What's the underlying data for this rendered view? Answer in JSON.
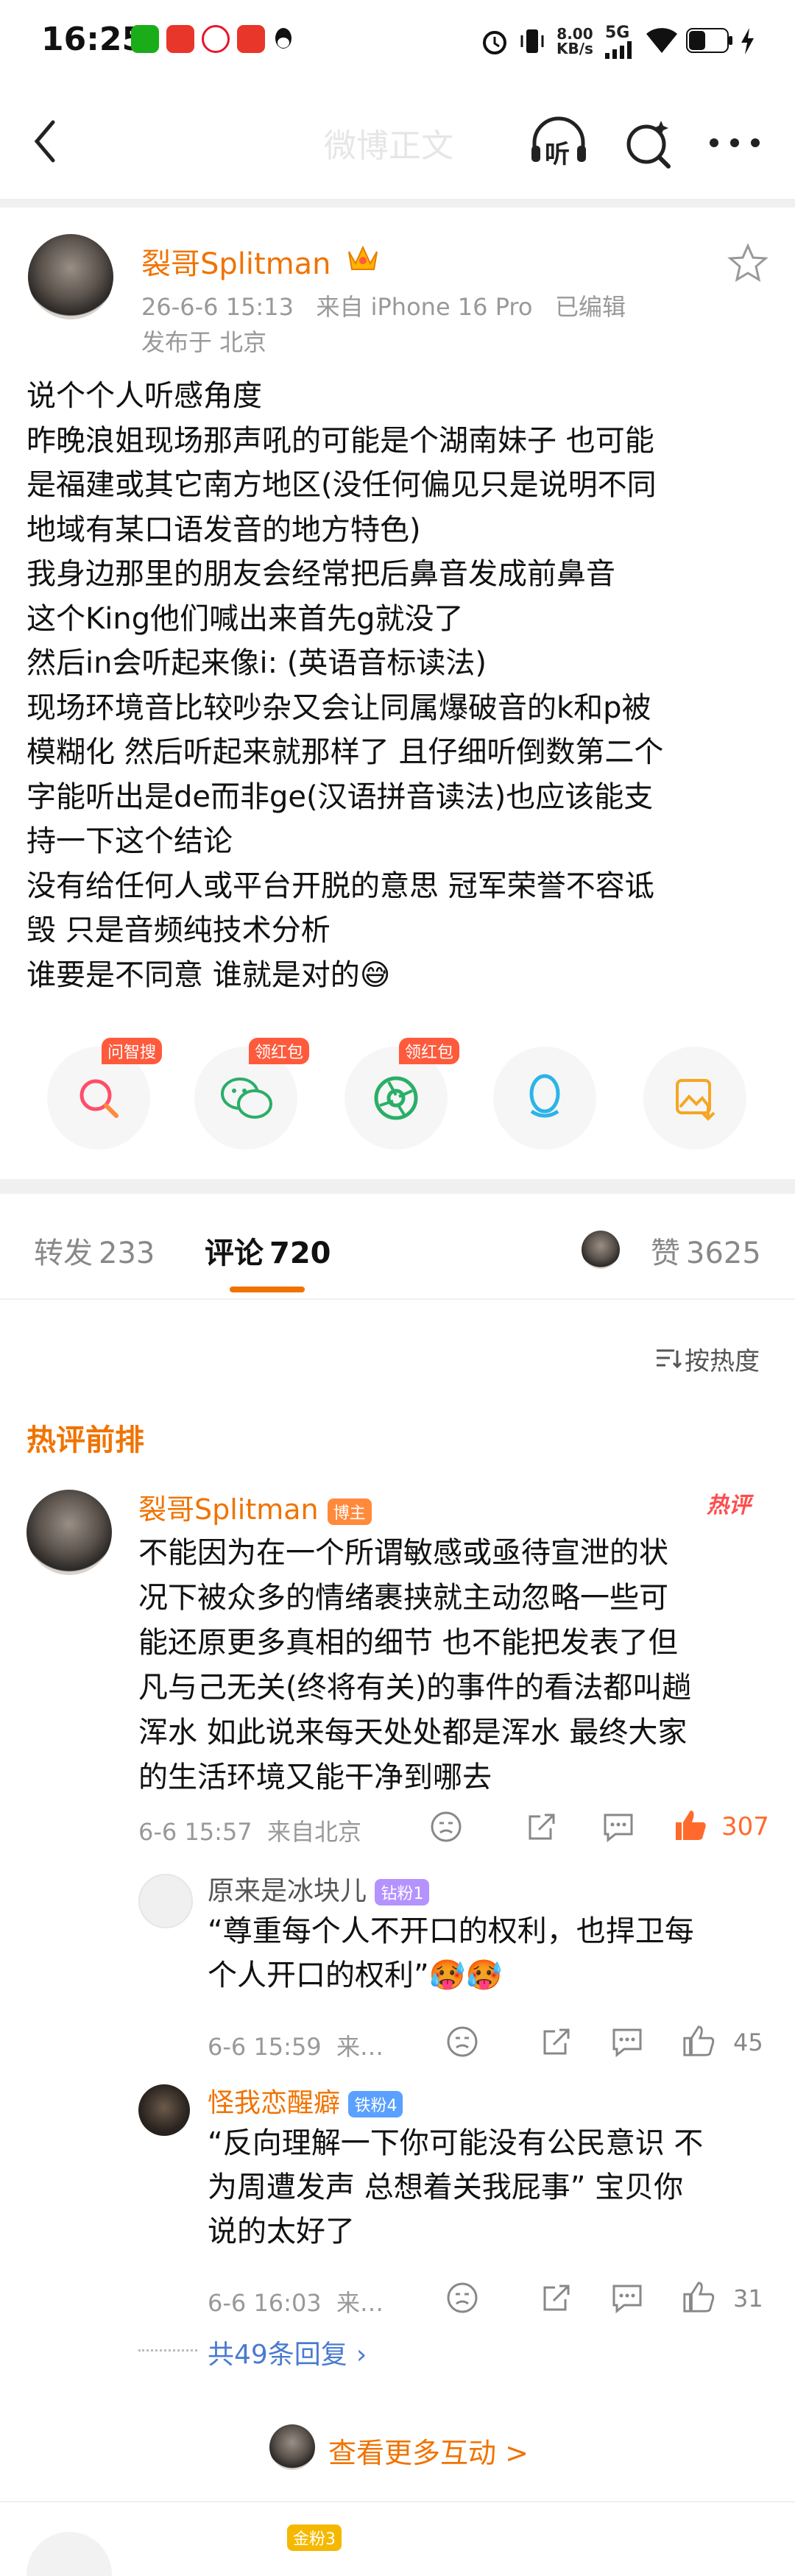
{
  "status_bar": {
    "time": "16:25",
    "net_speed_top": "8.00",
    "net_speed_unit": "KB/s",
    "signal_label": "5G"
  },
  "header": {
    "title": "微博正文",
    "listen_label": "听"
  },
  "post": {
    "author": "裂哥Splitman",
    "meta_line": "26-6-6 15:13   来自 iPhone 16 Pro   已编辑",
    "location": "发布于 北京",
    "lines": [
      "说个个人听感角度",
      "昨晚浪姐现场那声吼的可能是个湖南妹子 也可能",
      "是福建或其它南方地区(没任何偏见只是说明不同",
      "地域有某口语发音的地方特色)",
      "我身边那里的朋友会经常把后鼻音发成前鼻音",
      "这个King他们喊出来首先g就没了",
      "然后in会听起来像i: (英语音标读法)",
      "现场环境音比较吵杂又会让同属爆破音的k和p被",
      "模糊化 然后听起来就那样了 且仔细听倒数第二个",
      "字能听出是de而非ge(汉语拼音读法)也应该能支",
      "持一下这个结论",
      "没有给任何人或平台开脱的意思 冠军荣誉不容诋",
      "毁 只是音频纯技术分析",
      "谁要是不同意 谁就是对的"
    ],
    "last_emoji": "😅"
  },
  "share": {
    "items": [
      {
        "tag": "问智搜",
        "icon": "search-icon"
      },
      {
        "tag": "领红包",
        "icon": "wechat-icon"
      },
      {
        "tag": "领红包",
        "icon": "moments-icon"
      },
      {
        "tag": "",
        "icon": "qq-icon"
      },
      {
        "tag": "",
        "icon": "save-image-icon"
      }
    ]
  },
  "tabs": {
    "repost_label": "转发",
    "repost_count": "233",
    "comment_label": "评论",
    "comment_count": "720",
    "like_label": "赞",
    "like_count": "3625"
  },
  "sort": {
    "label": "按热度"
  },
  "hot_section": {
    "title": "热评前排"
  },
  "comment": {
    "author": "裂哥Splitman",
    "author_badge": "博主",
    "hot_tag": "热评",
    "lines": [
      "不能因为在一个所谓敏感或亟待宣泄的状",
      "况下被众多的情绪裹挟就主动忽略一些可",
      "能还原更多真相的细节 也不能把发表了但",
      "凡与己无关(终将有关)的事件的看法都叫趟",
      "浑水 如此说来每天处处都是浑水 最终大家",
      "的生活环境又能干净到哪去"
    ],
    "meta": "6-6 15:57  来自北京",
    "likes": "307"
  },
  "replies": [
    {
      "name": "原来是冰块儿",
      "badge": "钻粉1",
      "lines": [
        "“尊重每个人不开口的权利，也捍卫每",
        "个人开口的权利”🥵🥵"
      ],
      "meta": "6-6 15:59  来…",
      "likes": "45"
    },
    {
      "name": "怪我恋醒癖",
      "badge": "铁粉4",
      "lines": [
        "“反向理解一下你可能没有公民意识 不",
        "为周遭发声 总想着关我屁事” 宝贝你",
        "说的太好了"
      ],
      "meta": "6-6 16:03  来…",
      "likes": "31"
    }
  ],
  "more_replies": "共49条回复",
  "more_interactions": "查看更多互动 >",
  "next_badge": "金粉3"
}
